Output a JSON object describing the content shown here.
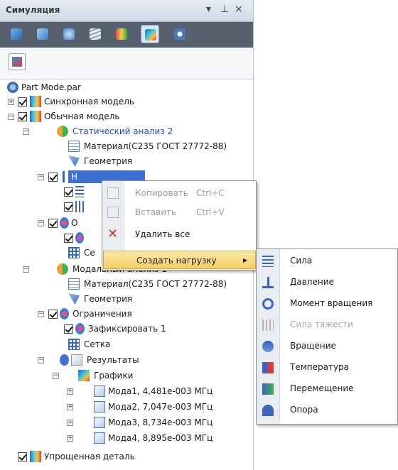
{
  "panel": {
    "title": "Симуляция",
    "controls": [
      "▾",
      "⊥",
      "×"
    ]
  },
  "toolbar": {
    "icons": [
      "assembly-icon",
      "copy-model-icon",
      "study-icon",
      "layers-icon",
      "mesh-icon",
      "results-icon",
      "report-icon"
    ],
    "selected_index": 5
  },
  "tree": {
    "root": "Part Mode.par",
    "sync_model": "Синхронная модель",
    "ordinary_model": "Обычная модель",
    "static_study": "Статический анализ 2",
    "material_1": "Материал(С235 ГОСТ 27772-88)",
    "geometry_1": "Геометрия",
    "loads_1": "Н",
    "constraints_1": "О",
    "mesh_1": "Се",
    "modal_study": "Модальный анализ 1",
    "material_2": "Материал(С235 ГОСТ 27772-88)",
    "geometry_2": "Геометрия",
    "constraints_2": "Ограничения",
    "fix_1": "Зафиксировать 1",
    "mesh_2": "Сетка",
    "results": "Результаты",
    "plots": "Графики",
    "modes": [
      "Мода1, 4,481е-003 МГц",
      "Мода2, 7,047е-003 МГц",
      "Мода3, 8,734е-003 МГц",
      "Мода4, 8,895е-003 МГц"
    ],
    "simplified": "Упрощенная деталь"
  },
  "context_menu": {
    "copy": "Копировать",
    "copy_shortcut": "Ctrl+C",
    "paste": "Вставить",
    "paste_shortcut": "Ctrl+V",
    "delete_all": "Удалить все",
    "create_load": "Создать нагрузку",
    "submenu_arrow": "▶"
  },
  "submenu": {
    "items": [
      "Сила",
      "Давление",
      "Момент вращения",
      "Сила тяжести",
      "Вращение",
      "Температура",
      "Перемещение",
      "Опора"
    ],
    "disabled_index": 3
  },
  "colors": {
    "accent_blue": "#2146c8",
    "highlight": "#f5cf63",
    "toolbar_bg": "#55606c"
  }
}
